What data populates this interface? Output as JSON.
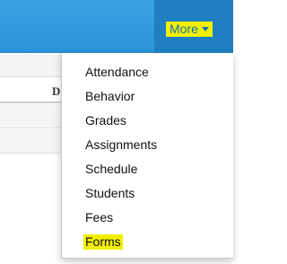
{
  "header": {
    "more_label": "More"
  },
  "table": {
    "header_label": "D"
  },
  "menu": {
    "items": [
      {
        "label": "Attendance"
      },
      {
        "label": "Behavior"
      },
      {
        "label": "Grades"
      },
      {
        "label": "Assignments"
      },
      {
        "label": "Schedule"
      },
      {
        "label": "Students"
      },
      {
        "label": "Fees"
      },
      {
        "label": "Forms"
      }
    ],
    "highlighted_item": "Forms"
  },
  "colors": {
    "topbar": "#2b93d8",
    "topbar_dark": "#1f7fc2",
    "highlight": "#f2f000"
  }
}
